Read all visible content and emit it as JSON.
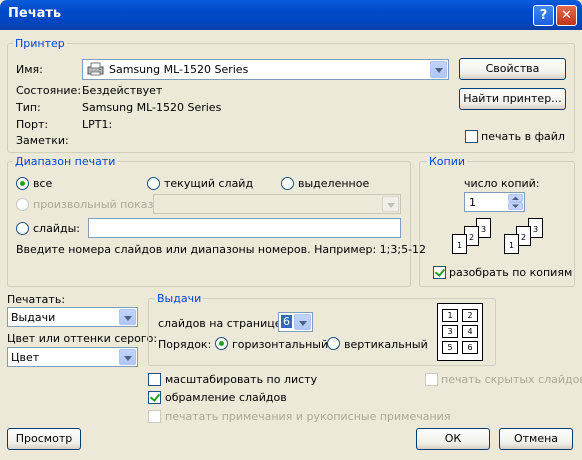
{
  "window": {
    "title": "Печать",
    "help_label": "?",
    "close_label": "✕"
  },
  "printer": {
    "legend": "Принтер",
    "name_label": "Имя:",
    "name_value": "Samsung ML-1520 Series",
    "properties_button": "Свойства",
    "find_button": "Найти принтер...",
    "status_label": "Состояние:",
    "status_value": "Бездействует",
    "type_label": "Тип:",
    "type_value": "Samsung ML-1520 Series",
    "port_label": "Порт:",
    "port_value": "LPT1:",
    "notes_label": "Заметки:",
    "print_to_file_label": "печать в файл",
    "print_to_file_checked": false
  },
  "print_range": {
    "legend": "Диапазон печати",
    "all_label": "все",
    "current_slide_label": "текущий слайд",
    "selection_label": "выделенное",
    "custom_show_label": "произвольный показ:",
    "slides_label": "слайды:",
    "slides_value": "",
    "hint": "Введите номера слайдов или диапазоны номеров. Например: 1;3;5-12",
    "selected": "all"
  },
  "copies": {
    "legend": "Копии",
    "count_label": "число копий:",
    "count_value": "1",
    "collate_label": "разобрать по копиям",
    "collate_checked": true,
    "page_numbers": [
      "1",
      "2",
      "3"
    ]
  },
  "print_what": {
    "label": "Печатать:",
    "value": "Выдачи"
  },
  "color": {
    "label": "Цвет или оттенки серого:",
    "value": "Цвет"
  },
  "handouts": {
    "legend": "Выдачи",
    "per_page_label": "слайдов на странице:",
    "per_page_value": "6",
    "order_label": "Порядок:",
    "horizontal_label": "горизонтальный",
    "vertical_label": "вертикальный",
    "order_selected": "horizontal",
    "preview_numbers": [
      "1",
      "2",
      "3",
      "4",
      "5",
      "6"
    ]
  },
  "options": {
    "scale_to_fit_label": "масштабировать по листу",
    "scale_to_fit_checked": false,
    "frame_slides_label": "обрамление слайдов",
    "frame_slides_checked": true,
    "print_comments_label": "печатать примечания и рукописные примечания",
    "print_hidden_label": "печать скрытых слайдов"
  },
  "buttons": {
    "preview": "Просмотр",
    "ok": "ОК",
    "cancel": "Отмена"
  }
}
